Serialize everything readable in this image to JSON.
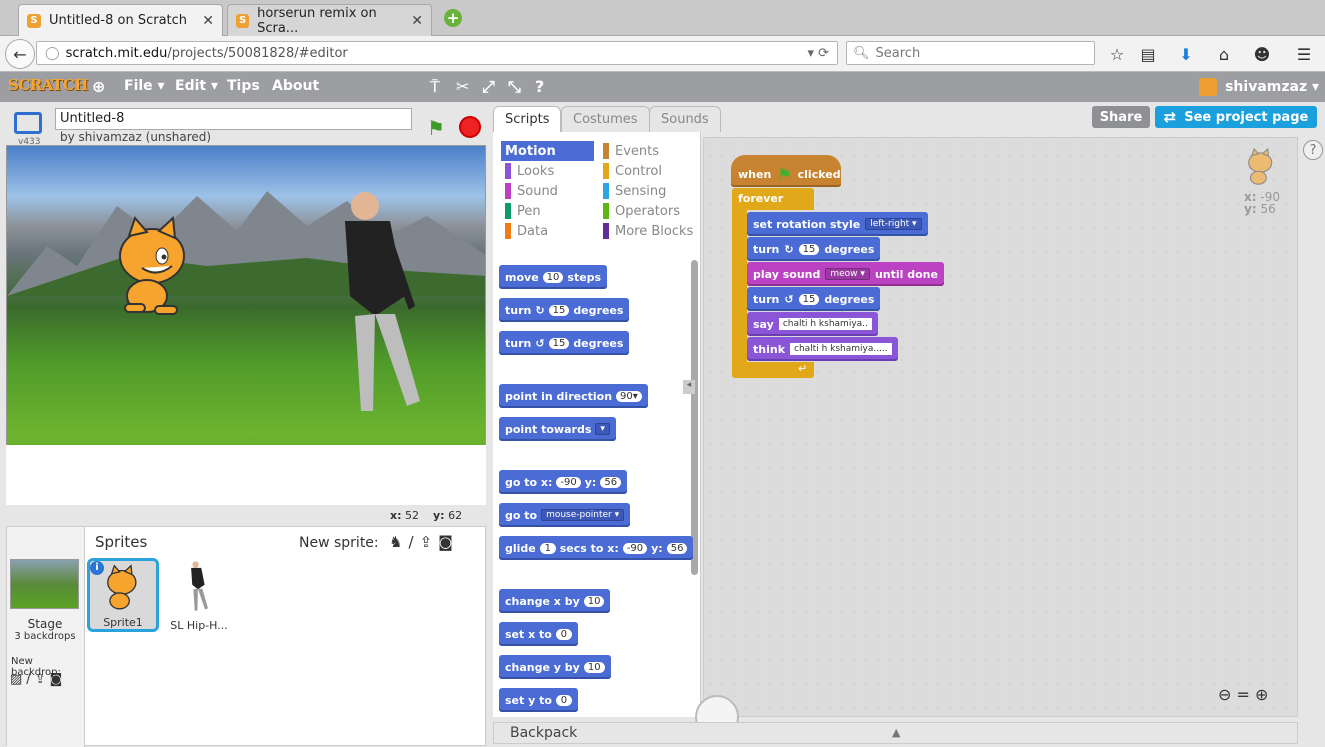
{
  "browser": {
    "tabs": [
      {
        "title": "Untitled-8 on Scratch",
        "active": true
      },
      {
        "title": "horserun remix on Scra...",
        "active": false
      }
    ],
    "url_prefix": "scratch.mit.edu",
    "url_path": "/projects/50081828/#editor",
    "search_placeholder": "Search"
  },
  "menu": {
    "logo": "SCRATCH",
    "items": [
      "File ▾",
      "Edit ▾",
      "Tips",
      "About"
    ],
    "user": "shivamzaz ▾"
  },
  "stage": {
    "version": "v433",
    "title": "Untitled-8",
    "byline": "by shivamzaz (unshared)",
    "mouse_x_label": "x:",
    "mouse_x": "52",
    "mouse_y_label": "y:",
    "mouse_y": "62"
  },
  "sprites": {
    "header": "Sprites",
    "new_sprite": "New sprite:",
    "stage_label": "Stage",
    "backdrops": "3 backdrops",
    "new_backdrop": "New backdrop:",
    "items": [
      {
        "name": "Sprite1",
        "selected": true
      },
      {
        "name": "SL Hip-H...",
        "selected": false
      }
    ]
  },
  "tabs": {
    "scripts": "Scripts",
    "costumes": "Costumes",
    "sounds": "Sounds"
  },
  "actions": {
    "share": "Share",
    "see_project": "See project page"
  },
  "categories": [
    {
      "label": "Motion",
      "color": "#4a6cd4"
    },
    {
      "label": "Looks",
      "color": "#8a55d7"
    },
    {
      "label": "Sound",
      "color": "#bb42c3"
    },
    {
      "label": "Pen",
      "color": "#0e9a6c"
    },
    {
      "label": "Data",
      "color": "#ee7d16"
    },
    {
      "label": "Events",
      "color": "#c88330"
    },
    {
      "label": "Control",
      "color": "#e1a91a"
    },
    {
      "label": "Sensing",
      "color": "#2ca5e2"
    },
    {
      "label": "Operators",
      "color": "#5cb712"
    },
    {
      "label": "More Blocks",
      "color": "#632d99"
    }
  ],
  "palette_blocks": {
    "move": {
      "a": "move",
      "n": "10",
      "b": "steps"
    },
    "turn_cw": {
      "a": "turn",
      "n": "15",
      "b": "degrees"
    },
    "turn_ccw": {
      "a": "turn",
      "n": "15",
      "b": "degrees"
    },
    "point_dir": {
      "a": "point in direction",
      "n": "90▾"
    },
    "point_towards": {
      "a": "point towards",
      "d": "▾"
    },
    "goto_xy": {
      "a": "go to x:",
      "x": "-90",
      "b": "y:",
      "y": "56"
    },
    "goto": {
      "a": "go to",
      "d": "mouse-pointer ▾"
    },
    "glide": {
      "a": "glide",
      "n": "1",
      "b": "secs to x:",
      "x": "-90",
      "c": "y:",
      "y": "56"
    },
    "change_x": {
      "a": "change x by",
      "n": "10"
    },
    "set_x": {
      "a": "set x to",
      "n": "0"
    },
    "change_y": {
      "a": "change y by",
      "n": "10"
    },
    "set_y": {
      "a": "set y to",
      "n": "0"
    }
  },
  "script": {
    "hat_a": "when",
    "hat_b": "clicked",
    "forever": "forever",
    "rot_a": "set rotation style",
    "rot_d": "left-right ▾",
    "turn1_a": "turn",
    "turn1_n": "15",
    "turn1_b": "degrees",
    "play_a": "play sound",
    "play_d": "meow ▾",
    "play_b": "until done",
    "turn2_a": "turn",
    "turn2_n": "15",
    "turn2_b": "degrees",
    "say_a": "say",
    "say_t": "chalti h kshamiya..",
    "think_a": "think",
    "think_t": "chalti h kshamiya....."
  },
  "sprite_info": {
    "x_label": "x:",
    "x": "-90",
    "y_label": "y:",
    "y": "56"
  },
  "backpack": "Backpack"
}
